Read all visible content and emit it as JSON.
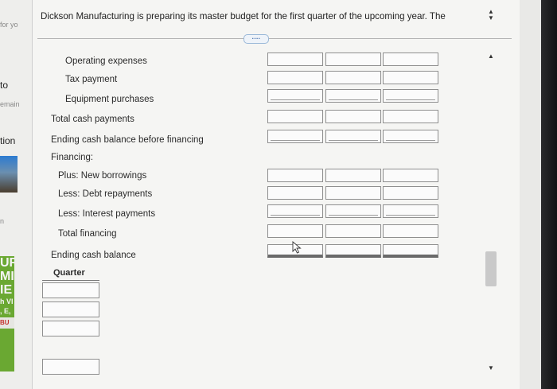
{
  "left_strip": {
    "snippets": [
      "for yo",
      "to ",
      "emain",
      "tion",
      "n",
      "UF",
      "MI",
      "IE",
      "h VI",
      ", E,",
      "BU"
    ]
  },
  "header": {
    "text": "Dickson Manufacturing is preparing its master budget for the first quarter of the upcoming year. The"
  },
  "expand_button": {
    "label": "····"
  },
  "rows": [
    {
      "label": "Operating expenses"
    },
    {
      "label": "Tax payment"
    },
    {
      "label": "Equipment purchases"
    },
    {
      "label": "Total cash payments"
    },
    {
      "label": "Ending cash balance before financing"
    },
    {
      "label": "Financing:"
    },
    {
      "label": "Plus: New borrowings"
    },
    {
      "label": "Less: Debt repayments"
    },
    {
      "label": "Less: Interest payments"
    },
    {
      "label": "Total financing"
    },
    {
      "label": "Ending cash balance"
    }
  ],
  "quarter_label": "Quarter",
  "icons": {
    "spinner": "up-down-spinner-icon",
    "cursor": "mouse-pointer-icon",
    "scroll_up": "scroll-up-arrow-icon",
    "scroll_down": "scroll-down-arrow-icon"
  }
}
